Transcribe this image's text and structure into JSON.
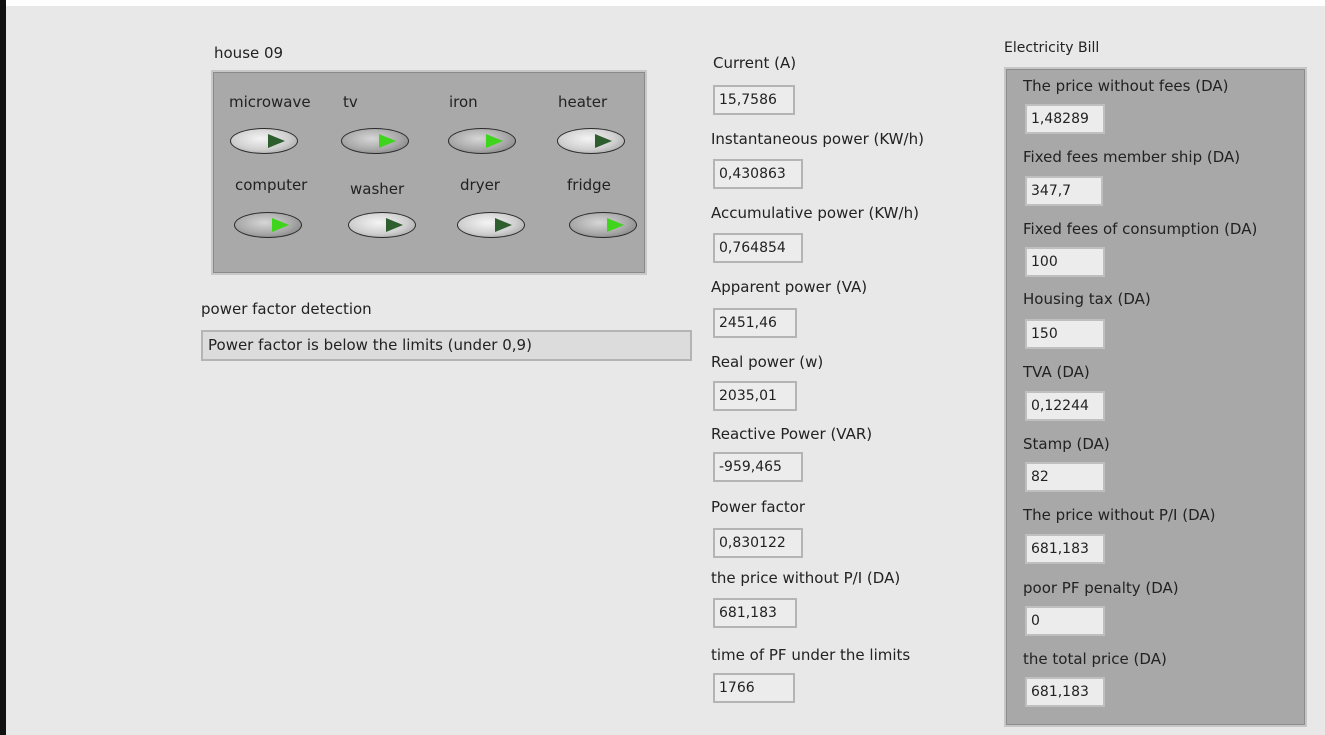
{
  "house": {
    "title": "house 09",
    "devices": [
      {
        "label": "microwave",
        "on": false
      },
      {
        "label": "tv",
        "on": true
      },
      {
        "label": "iron",
        "on": true
      },
      {
        "label": "heater",
        "on": false
      },
      {
        "label": "computer",
        "on": true
      },
      {
        "label": "washer",
        "on": false
      },
      {
        "label": "dryer",
        "on": false
      },
      {
        "label": "fridge",
        "on": true
      }
    ]
  },
  "pf_detection": {
    "label": "power factor detection",
    "message": "Power factor is below the limits (under 0,9)"
  },
  "measurements": [
    {
      "label": "Current (A)",
      "value": "15,7586"
    },
    {
      "label": "Instantaneous power (KW/h)",
      "value": "0,430863"
    },
    {
      "label": "Accumulative power (KW/h)",
      "value": "0,764854"
    },
    {
      "label": "Apparent power (VA)",
      "value": "2451,46"
    },
    {
      "label": "Real power (w)",
      "value": "2035,01"
    },
    {
      "label": "Reactive Power (VAR)",
      "value": "-959,465"
    },
    {
      "label": "Power factor",
      "value": "0,830122"
    },
    {
      "label": "the price without P/I (DA)",
      "value": "681,183"
    },
    {
      "label": "time of PF under the limits",
      "value": "1766"
    }
  ],
  "bill": {
    "title": "Electricity Bill",
    "items": [
      {
        "label": "The price without fees  (DA)",
        "value": "1,48289"
      },
      {
        "label": "Fixed fees member ship (DA)",
        "value": "347,7"
      },
      {
        "label": "Fixed fees of consumption (DA)",
        "value": "100"
      },
      {
        "label": "Housing tax (DA)",
        "value": "150"
      },
      {
        "label": "TVA (DA)",
        "value": "0,12244"
      },
      {
        "label": "Stamp (DA)",
        "value": "82"
      },
      {
        "label": "The price without P/I (DA)",
        "value": "681,183"
      },
      {
        "label": "poor PF penalty (DA)",
        "value": "0"
      },
      {
        "label": "the total price (DA)",
        "value": "681,183"
      }
    ]
  },
  "colors": {
    "switch_on": "#3fd51c",
    "switch_off": "#2e5d2e",
    "panel": "#a9a9a9",
    "background": "#e8e8e8"
  }
}
